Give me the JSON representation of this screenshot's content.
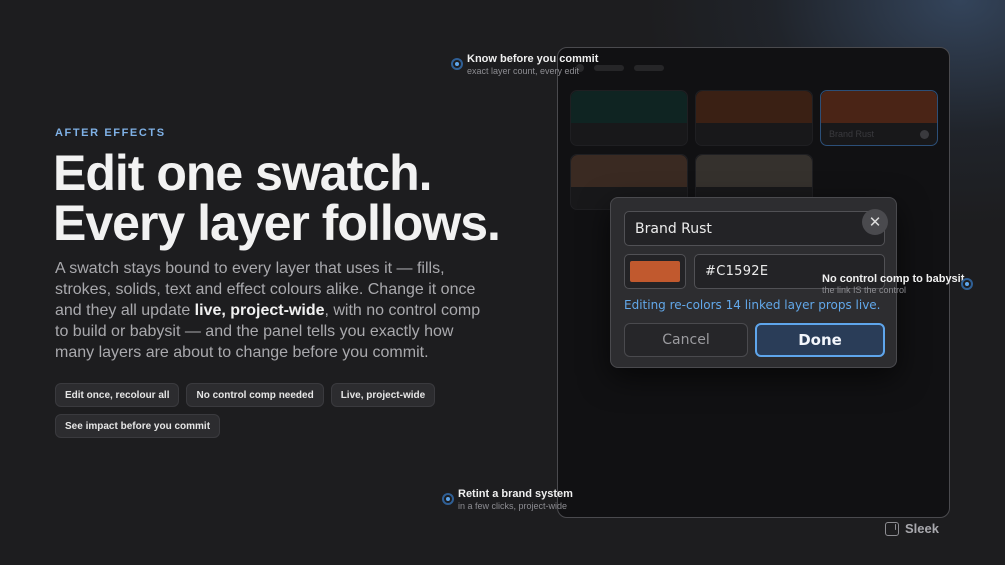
{
  "eyebrow": "AFTER EFFECTS",
  "headline": {
    "line1": "Edit one swatch.",
    "line2": "Every layer follows."
  },
  "body": {
    "part1": "A swatch stays bound to every layer that uses it — fills, strokes, solids, text and effect colours alike. Change it once and they all update ",
    "emphasis": "live, project-wide",
    "part2": ", with no control comp to build or babysit — and the panel tells you exactly how many layers are about to change before you commit."
  },
  "pills": [
    "Edit once, recolour all",
    "No control comp needed",
    "Live, project-wide",
    "See impact before you commit"
  ],
  "panel": {
    "swatches": [
      {
        "label": "",
        "color": "#0f2422"
      },
      {
        "label": "",
        "color": "#3a2014"
      },
      {
        "label": "Brand Rust",
        "color": "#4a2416",
        "selected": true
      },
      {
        "label": "",
        "color": "#3a2a22"
      },
      {
        "label": "",
        "color": "#35312d"
      }
    ]
  },
  "dialog": {
    "name_value": "Brand Rust",
    "close_glyph": "✕",
    "swatch_color": "#C1592E",
    "hex_value": "#C1592E",
    "impact_note": "Editing re-colors 14 linked layer props live.",
    "cancel_label": "Cancel",
    "done_label": "Done"
  },
  "callouts": {
    "top": {
      "title": "Know before you commit",
      "sub": "exact layer count, every edit"
    },
    "right": {
      "title": "No control comp to babysit",
      "sub": "the link IS the control"
    },
    "bottom": {
      "title": "Retint a brand system",
      "sub": "in a few clicks, project-wide"
    }
  },
  "brand": {
    "name": "Sleek"
  },
  "colors": {
    "accent": "#5fa6ec",
    "eyebrow": "#7fb1e6",
    "background": "#1d1d1f"
  }
}
